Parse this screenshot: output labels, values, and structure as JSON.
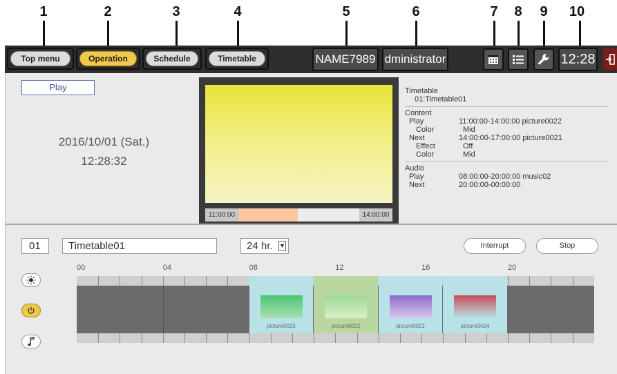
{
  "callouts": [
    "1",
    "2",
    "3",
    "4",
    "5",
    "6",
    "7",
    "8",
    "9",
    "10"
  ],
  "nav": {
    "top_menu": "Top menu",
    "operation": "Operation",
    "schedule": "Schedule",
    "timetable": "Timetable"
  },
  "header": {
    "display_name": "NAME7989",
    "user": "dministrator",
    "clock": "12:28"
  },
  "status": {
    "state": "Play",
    "date": "2016/10/01 (Sat.)",
    "time": "12:28:32",
    "progress_start": "11:00:00",
    "progress_end": "14:00:00",
    "progress_fraction": 0.49
  },
  "info": {
    "timetable_label": "Timetable",
    "timetable_value": "01:Timetable01",
    "content_label": "Content",
    "play_label": "Play",
    "play_value": "11:00:00-14:00:00  picture0022",
    "color_label": "Color",
    "play_color": "Mid",
    "next_label": "Next",
    "next_value": "14:00:00-17:00:00  picture0021",
    "effect_label": "Effect",
    "effect_value": "Off",
    "next_color": "Mid",
    "audio_label": "Audio",
    "audio_play_label": "Play",
    "audio_play_value": "08:00:00-20:00:00  music02",
    "audio_next_label": "Next",
    "audio_next_value": "20:00:00-00:00:00"
  },
  "timetable": {
    "number": "01",
    "name": "Timetable01",
    "range": "24 hr.",
    "interrupt": "Interrupt",
    "stop": "Stop",
    "hours": [
      "00",
      "04",
      "08",
      "12",
      "16",
      "20"
    ],
    "blocks": [
      {
        "name": "picture0025",
        "time": "08:00:00 - 11:00:00",
        "color_top": "#4cc474",
        "color_bottom": "#a8e0b0",
        "current": false
      },
      {
        "name": "picture0022",
        "time": "11:00:00 - 14:00:00",
        "color_top": "#9ed89a",
        "color_bottom": "#d8f0c4",
        "current": true
      },
      {
        "name": "picture0021",
        "time": "14:00:00 - 17:00:00",
        "color_top": "#8c6cc8",
        "color_bottom": "#d8c8f0",
        "current": false
      },
      {
        "name": "picture0024",
        "time": "17:00:00 - 20:00:00",
        "color_top": "#c84a5a",
        "color_bottom": "#b8e2e8",
        "current": false
      }
    ]
  },
  "icons": {
    "brightness": "sun-icon",
    "power": "power-icon",
    "audio": "music-note-icon",
    "calendar": "calendar-icon",
    "list": "list-icon",
    "settings": "wrench-icon",
    "logout": "logout-icon"
  },
  "colors": {
    "accent": "#f0c84a",
    "topbar": "#2e2e2e",
    "panel": "#eaeaea",
    "active_block": "#b8e2e8"
  }
}
